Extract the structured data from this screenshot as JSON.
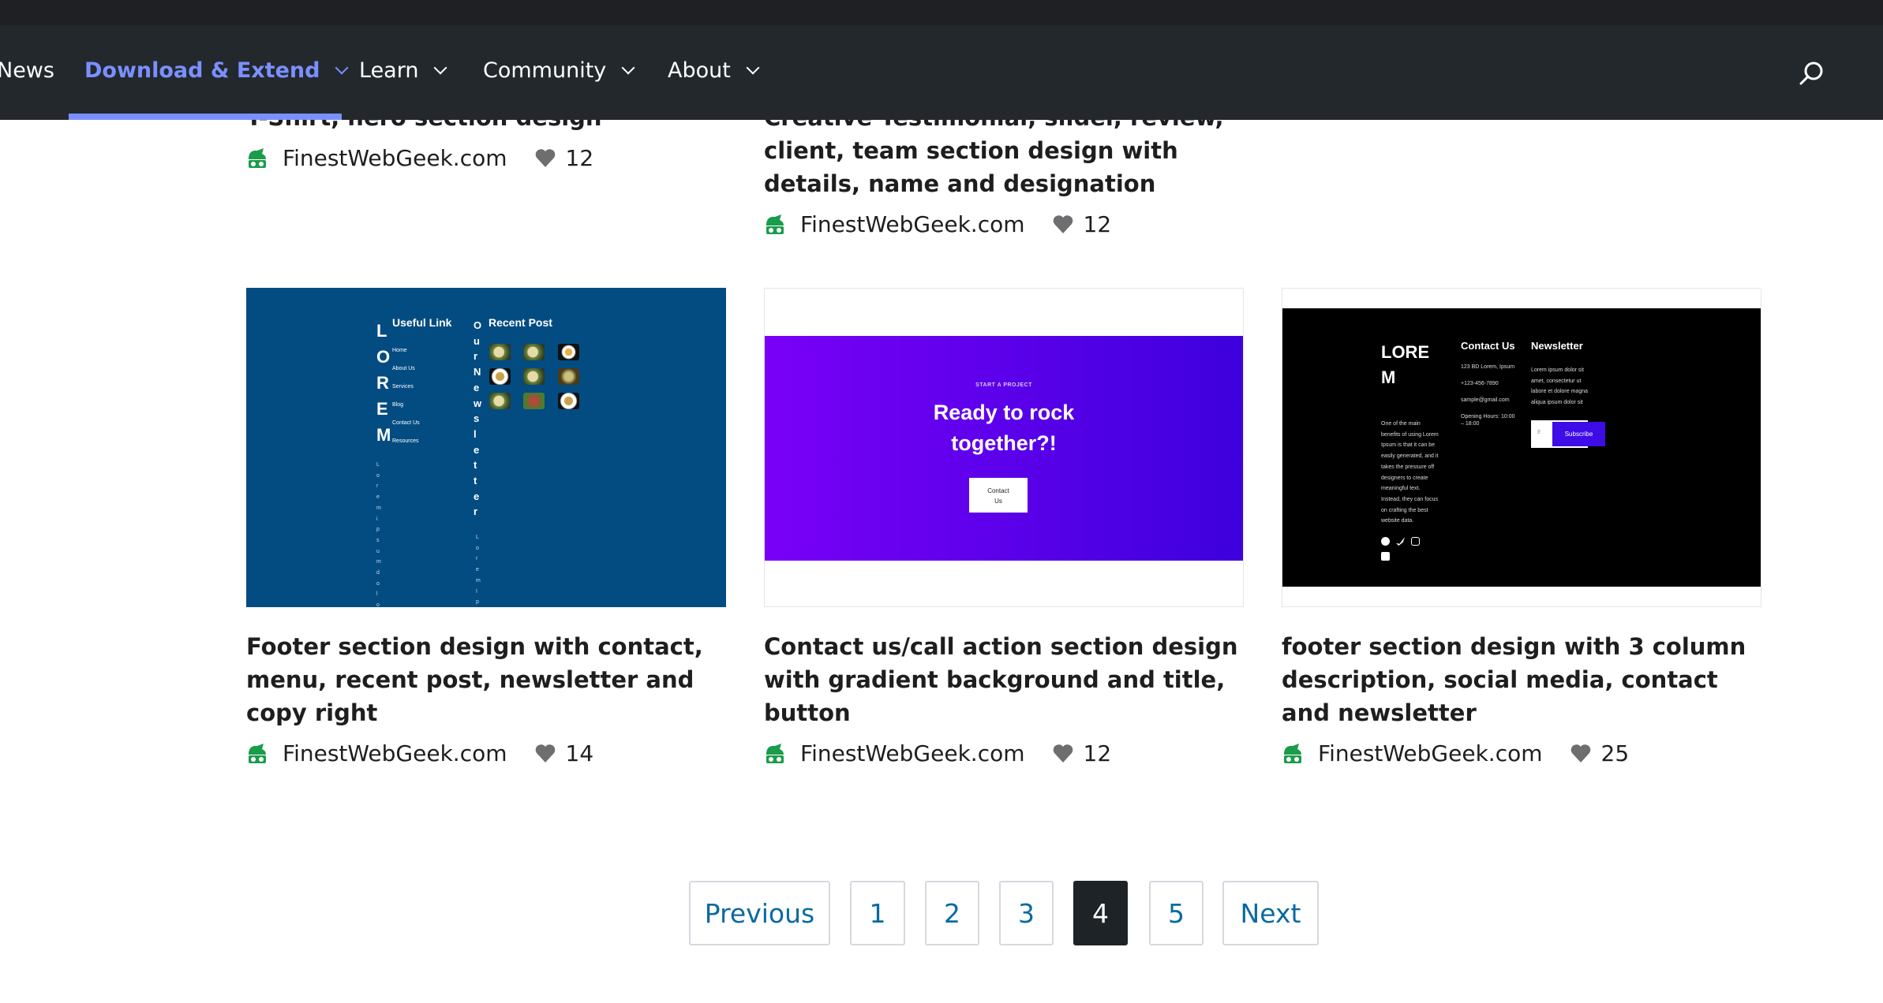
{
  "nav": {
    "items": [
      {
        "label": "News",
        "has_dropdown": false
      },
      {
        "label": "Download & Extend",
        "has_dropdown": true,
        "active": true
      },
      {
        "label": "Learn",
        "has_dropdown": true
      },
      {
        "label": "Community",
        "has_dropdown": true
      },
      {
        "label": "About",
        "has_dropdown": true
      }
    ],
    "search_icon": "search-icon",
    "accent": "#7b90ff"
  },
  "cards_row1": [
    {
      "title": "T-Shirt, hero section design",
      "author": "FinestWebGeek.com",
      "likes": "12"
    },
    {
      "title": "Creative Testimonial, slider, review, client, team section design with details, name and designation",
      "author": "FinestWebGeek.com",
      "likes": "12"
    }
  ],
  "cards_row2": [
    {
      "title": "Footer section design with contact, menu, recent post, newsletter and copy right",
      "author": "FinestWebGeek.com",
      "likes": "14",
      "preview": {
        "logo_letters": [
          "L",
          "O",
          "R",
          "E",
          "M"
        ],
        "useful_link": "Useful Link",
        "links": [
          "Home",
          "About Us",
          "Services",
          "Blog",
          "Contact Us",
          "Resources"
        ],
        "newsletter_letters": [
          "O",
          "u",
          "r",
          "N",
          "e",
          "w",
          "s",
          "l",
          "e",
          "t",
          "t",
          "e",
          "r"
        ],
        "recent_post": "Recent Post",
        "lorem_vertical": [
          "L",
          "o",
          "r",
          "e",
          "m",
          "i",
          "p",
          "s",
          "u",
          "m",
          "d",
          "o",
          "l",
          "o"
        ],
        "lorem_vertical2": [
          "L",
          "o",
          "r",
          "e",
          "m",
          "I",
          "p"
        ],
        "bg": "#034c82"
      }
    },
    {
      "title": "Contact us/call action section design with gradient background and title, button",
      "author": "FinestWebGeek.com",
      "likes": "12",
      "preview": {
        "eyebrow": "START A PROJECT",
        "heading_line1": "Ready to rock",
        "heading_line2": "together?!",
        "button_line1": "Contact",
        "button_line2": "Us",
        "gradient_from": "#7a00f7",
        "gradient_to": "#3d00dd"
      }
    },
    {
      "title": "footer section design with 3 column description, social media, contact and newsletter",
      "author": "FinestWebGeek.com",
      "likes": "25",
      "preview": {
        "logo_line1": "LORE",
        "logo_line2": "M",
        "description": [
          "One of the main",
          "benefits of using Lorem",
          "Ipsum is that it can be",
          "easily generated, and it",
          "takes the pressure off",
          "designers to create",
          "meaningful text.",
          "Instead, they can focus",
          "on crafting the best",
          "website data."
        ],
        "contact_heading": "Contact Us",
        "contact_lines": [
          "123 BD Lorem, Ipsum",
          "+123-456-7890",
          "sample@gmail.com",
          "Opening Hours: 10:00 – 18:00"
        ],
        "newsletter_heading": "Newsletter",
        "newsletter_text": [
          "Lorem ipsum dolor sit",
          "amet, consectetur ut",
          "labore et dolore magna",
          "aliqua ipsum dolor sit"
        ],
        "email_placeholder": "E",
        "subscribe": "Subscribe",
        "social_icons": [
          "facebook-icon",
          "twitter-icon",
          "instagram-icon",
          "linkedin-icon"
        ],
        "button_color": "#3d0ce6"
      }
    }
  ],
  "pagination": {
    "previous": "Previous",
    "pages": [
      "1",
      "2",
      "3",
      "4",
      "5"
    ],
    "current": "4",
    "next": "Next"
  }
}
